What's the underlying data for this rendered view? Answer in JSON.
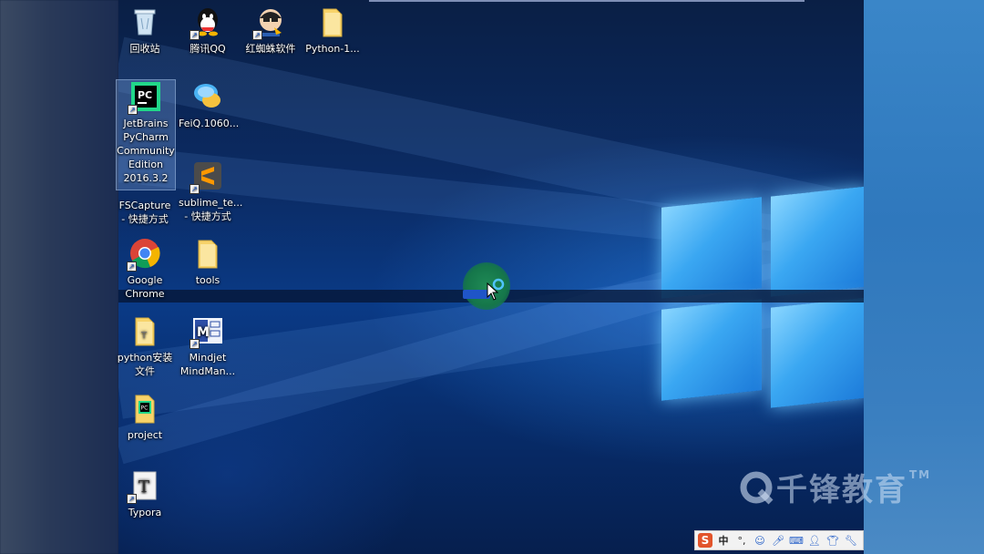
{
  "desktop": {
    "icons": [
      {
        "label": "回收站",
        "icon": "recycle-bin-icon"
      },
      {
        "label": "腾讯QQ",
        "icon": "qq-icon"
      },
      {
        "label": "红蜘蛛软件",
        "icon": "red-spider-icon"
      },
      {
        "label": "Python-1...",
        "icon": "folder-icon"
      },
      {
        "label": "JetBrains PyCharm Community Edition 2016.3.2",
        "icon": "pycharm-icon"
      },
      {
        "label": "FeiQ.1060...",
        "icon": "feiq-icon"
      },
      {
        "label": "FSCapture - 快捷方式",
        "icon": "fscapture-icon"
      },
      {
        "label": "sublime_te... - 快捷方式",
        "icon": "sublime-text-icon"
      },
      {
        "label": "Google Chrome",
        "icon": "chrome-icon"
      },
      {
        "label": "tools",
        "icon": "folder-icon"
      },
      {
        "label": "python安装文件",
        "icon": "folder-icon"
      },
      {
        "label": "Mindjet MindMan...",
        "icon": "mindmanager-icon"
      },
      {
        "label": "project",
        "icon": "pycharm-project-icon"
      },
      {
        "label": "Typora",
        "icon": "typora-icon"
      }
    ]
  },
  "watermark": {
    "text": "千锋教育",
    "tm": "TM"
  },
  "ime_bar": {
    "logo": "S",
    "mode": "中",
    "punct": "°,",
    "items": [
      "emoji-icon",
      "microphone-icon",
      "keyboard-icon",
      "user-icon",
      "shirt-icon",
      "wrench-icon"
    ]
  },
  "colors": {
    "wallpaper_base": "#0b2c66",
    "logo_blue": "#3aa7f2",
    "ime_logo": "#e2542b"
  }
}
